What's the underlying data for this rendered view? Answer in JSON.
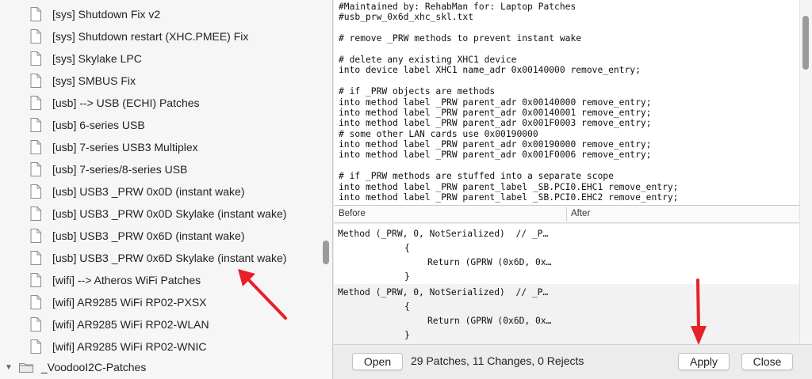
{
  "sidebar": {
    "items": [
      {
        "label": "[sys] Shutdown Fix v2"
      },
      {
        "label": "[sys] Shutdown restart (XHC.PMEE) Fix"
      },
      {
        "label": "[sys] Skylake LPC"
      },
      {
        "label": "[sys] SMBUS Fix"
      },
      {
        "label": "[usb] --> USB (ECHI) Patches"
      },
      {
        "label": "[usb] 6-series USB"
      },
      {
        "label": "[usb] 7-series USB3 Multiplex"
      },
      {
        "label": "[usb] 7-series/8-series USB"
      },
      {
        "label": "[usb] USB3 _PRW 0x0D (instant wake)"
      },
      {
        "label": "[usb] USB3 _PRW 0x0D Skylake (instant wake)"
      },
      {
        "label": "[usb] USB3 _PRW 0x6D (instant wake)"
      },
      {
        "label": "[usb] USB3 _PRW 0x6D Skylake (instant wake)"
      },
      {
        "label": "[wifi] --> Atheros WiFi Patches"
      },
      {
        "label": "[wifi] AR9285 WiFi RP02-PXSX"
      },
      {
        "label": "[wifi] AR9285 WiFi RP02-WLAN"
      },
      {
        "label": "[wifi] AR9285 WiFi RP02-WNIC"
      }
    ],
    "folder": {
      "label": "_VoodooI2C-Patches",
      "icon": "folder-icon"
    }
  },
  "editor": {
    "lines": [
      "#Maintained by: RehabMan for: Laptop Patches",
      "#usb_prw_0x6d_xhc_skl.txt",
      "",
      "# remove _PRW methods to prevent instant wake",
      "",
      "# delete any existing XHC1 device",
      "into device label XHC1 name_adr 0x00140000 remove_entry;",
      "",
      "# if _PRW objects are methods",
      "into method label _PRW parent_adr 0x00140000 remove_entry;",
      "into method label _PRW parent_adr 0x00140001 remove_entry;",
      "into method label _PRW parent_adr 0x001F0003 remove_entry;",
      "# some other LAN cards use 0x00190000",
      "into method label _PRW parent_adr 0x00190000 remove_entry;",
      "into method label _PRW parent_adr 0x001F0006 remove_entry;",
      "",
      "# if _PRW methods are stuffed into a separate scope",
      "into method label _PRW parent_label _SB.PCI0.EHC1 remove_entry;",
      "into method label _PRW parent_label _SB.PCI0.EHC2 remove_entry;"
    ]
  },
  "diff": {
    "header_before": "Before",
    "header_after": "After",
    "blocks": [
      {
        "l1": "Method (_PRW, 0, NotSerialized)  // _P…",
        "l2": "{",
        "l3": "Return (GPRW (0x6D, 0x…",
        "l4": "}"
      },
      {
        "l1": "Method (_PRW, 0, NotSerialized)  // _P…",
        "l2": "{",
        "l3": "Return (GPRW (0x6D, 0x…",
        "l4": "}"
      }
    ]
  },
  "bottom": {
    "open_label": "Open",
    "status": "29 Patches, 11 Changes, 0 Rejects",
    "apply_label": "Apply",
    "close_label": "Close"
  },
  "colors": {
    "arrow": "#e8202a",
    "selection_alt": "#f2f2f2"
  }
}
